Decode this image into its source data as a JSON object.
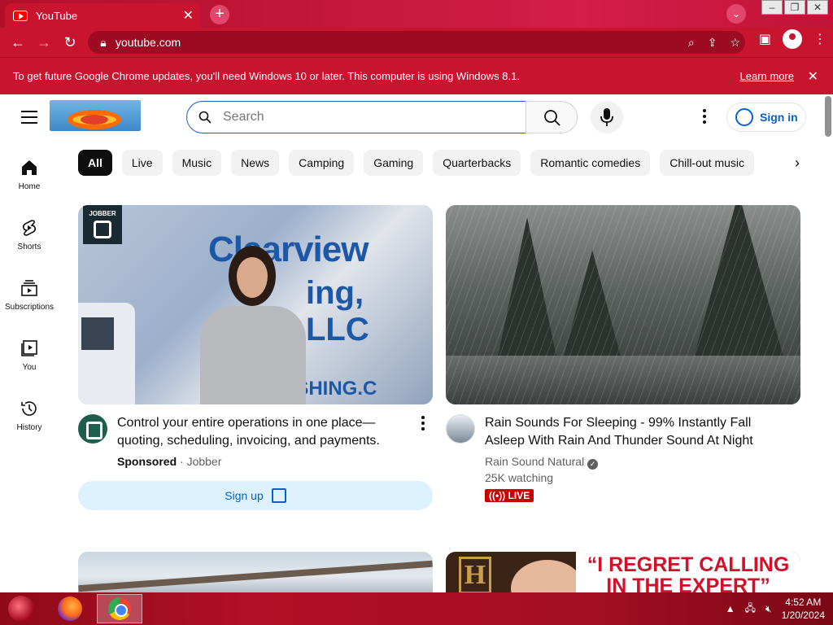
{
  "browser": {
    "tab_title": "YouTube",
    "tab_close": "✕",
    "url": "youtube.com",
    "infobar_text": "To get future Google Chrome updates, you'll need Windows 10 or later. This computer is using Windows 8.1.",
    "infobar_link": "Learn more"
  },
  "youtube": {
    "search_placeholder": "Search",
    "signin_label": "Sign in",
    "rail": [
      {
        "label": "Home"
      },
      {
        "label": "Shorts"
      },
      {
        "label": "Subscriptions"
      },
      {
        "label": "You"
      },
      {
        "label": "History"
      }
    ],
    "chips": [
      "All",
      "Live",
      "Music",
      "News",
      "Camping",
      "Gaming",
      "Quarterbacks",
      "Romantic comedies",
      "Chill-out music"
    ],
    "videos": [
      {
        "title": "Control your entire operations in one place—quoting, scheduling, invoicing, and payments.",
        "sponsored": "Sponsored",
        "channel": "Jobber",
        "cta": "Sign up",
        "thumb_brand_1": "Clearview",
        "thumb_brand_2": "ing, LLC",
        "thumb_brand_3": "ASHING.C",
        "thumb_badge": "JOBBER"
      },
      {
        "title": "Rain Sounds For Sleeping - 99% Instantly Fall Asleep With Rain And Thunder Sound At Night",
        "channel": "Rain Sound Natural",
        "stats": "25K watching",
        "badge": "LIVE"
      },
      {
        "title": ""
      },
      {
        "thumb_logo": "H",
        "thumb_quote_1": "“I REGRET CALLING",
        "thumb_quote_2": "IN THE EXPERT”"
      }
    ]
  },
  "taskbar": {
    "time": "4:52 AM",
    "date": "1/20/2024"
  },
  "colors": {
    "chrome_theme": "#c8142f",
    "yt_blue": "#065fd4",
    "live_red": "#cc0000"
  }
}
